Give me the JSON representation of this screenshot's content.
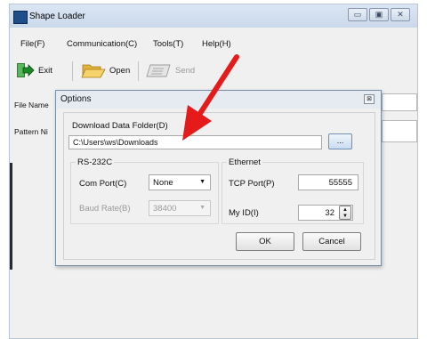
{
  "window": {
    "title": "Shape Loader",
    "controls": [
      "minimize",
      "maximize",
      "close"
    ]
  },
  "menu": [
    "File(F)",
    "Communication(C)",
    "Tools(T)",
    "Help(H)"
  ],
  "toolbar": {
    "exit_label": "Exit",
    "open_label": "Open",
    "send_label": "Send"
  },
  "main": {
    "file_name_label": "File Name",
    "pattern_label": "Pattern Ni"
  },
  "dialog": {
    "title": "Options",
    "close_glyph": "⊠",
    "download_folder_label": "Download Data Folder(D)",
    "download_folder_value": "C:\\Users\\ws\\Downloads",
    "browse_label": "...",
    "rs232c": {
      "title": "RS-232C",
      "com_port_label": "Com Port(C)",
      "com_port_value": "None",
      "baud_rate_label": "Baud Rate(B)",
      "baud_rate_value": "38400"
    },
    "ethernet": {
      "title": "Ethernet",
      "tcp_port_label": "TCP Port(P)",
      "tcp_port_value": "55555",
      "my_id_label": "My ID(I)",
      "my_id_value": "32"
    },
    "ok_label": "OK",
    "cancel_label": "Cancel"
  },
  "colors": {
    "annotation_arrow": "#e51a1a",
    "title_bar": "#c9d8ea"
  }
}
